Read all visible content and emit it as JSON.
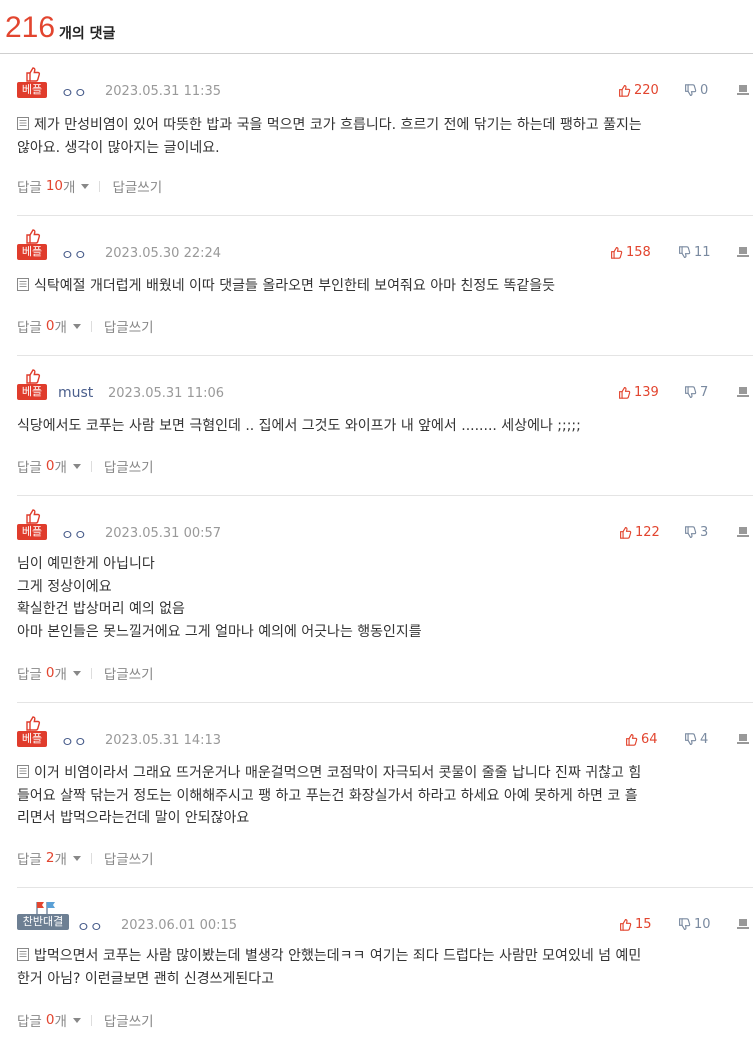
{
  "header": {
    "count": "216",
    "label": "개의 댓글"
  },
  "comments": [
    {
      "badge": "베플",
      "author": "ㅇㅇ",
      "date": "2023.05.31 11:35",
      "likes": "220",
      "dislikes": "0",
      "lines": [
        "제가 만성비염이 있어 따뜻한 밥과 국을 먹으면 코가 흐릅니다. 흐르기 전에 닦기는 하는데 팽하고 풀지는",
        "않아요. 생각이 많아지는 글이네요."
      ],
      "reply_label": "답글",
      "reply_count": "10",
      "reply_unit": "개",
      "write_label": "답글쓰기"
    },
    {
      "badge": "베플",
      "author": "ㅇㅇ",
      "date": "2023.05.30 22:24",
      "likes": "158",
      "dislikes": "11",
      "lines": [
        "식탁예절 개더럽게 배웠네 이따 댓글들 올라오면 부인한테 보여줘요 아마 친정도 똑같을듯"
      ],
      "reply_label": "답글",
      "reply_count": "0",
      "reply_unit": "개",
      "write_label": "답글쓰기"
    },
    {
      "badge": "베플",
      "author": "must",
      "date": "2023.05.31 11:06",
      "likes": "139",
      "dislikes": "7",
      "lines": [
        "식당에서도 코푸는 사람 보면 극혐인데 .. 집에서 그것도 와이프가 내 앞에서 ........ 세상에나 ;;;;;"
      ],
      "reply_label": "답글",
      "reply_count": "0",
      "reply_unit": "개",
      "write_label": "답글쓰기"
    },
    {
      "badge": "베플",
      "author": "ㅇㅇ",
      "date": "2023.05.31 00:57",
      "likes": "122",
      "dislikes": "3",
      "lines": [
        "님이 예민한게 아닙니다",
        "그게 정상이에요",
        "확실한건 밥상머리 예의 없음",
        "아마 본인들은 못느낄거에요 그게 얼마나 예의에 어긋나는 행동인지를"
      ],
      "reply_label": "답글",
      "reply_count": "0",
      "reply_unit": "개",
      "write_label": "답글쓰기"
    },
    {
      "badge": "베플",
      "author": "ㅇㅇ",
      "date": "2023.05.31 14:13",
      "likes": "64",
      "dislikes": "4",
      "lines": [
        "이거 비염이라서 그래요 뜨거운거나 매운걸먹으면 코점막이 자극되서 콧물이 줄줄 납니다 진짜 귀찮고 힘",
        "들어요 살짝 닦는거 정도는 이해해주시고 팽 하고 푸는건 화장실가서 하라고 하세요 아예 못하게 하면 코 흘",
        "리면서 밥먹으라는건데 말이 안되잖아요"
      ],
      "reply_label": "답글",
      "reply_count": "2",
      "reply_unit": "개",
      "write_label": "답글쓰기"
    },
    {
      "badge": "찬반대결",
      "author": "ㅇㅇ",
      "date": "2023.06.01 00:15",
      "likes": "15",
      "dislikes": "10",
      "lines": [
        "밥먹으면서 코푸는 사람 많이봤는데 별생각 안했는데ㅋㅋ 여기는 죄다 드럽다는 사람만 모여있네 넘 예민",
        "한거 아님? 이런글보면 괜히 신경쓰게된다고"
      ],
      "reply_label": "답글",
      "reply_count": "0",
      "reply_unit": "개",
      "write_label": "답글쓰기"
    }
  ],
  "colors": {
    "accent": "#e2452f",
    "badge_red": "#e03c2c",
    "badge_blue": "#6d7f93",
    "author": "#4a5e8c"
  },
  "icons": {
    "like": "thumbs-up-icon",
    "dislike": "thumbs-down-icon",
    "report": "report-icon",
    "doc": "document-icon",
    "best": "best-thumb-icon",
    "vs": "flag-icon"
  }
}
